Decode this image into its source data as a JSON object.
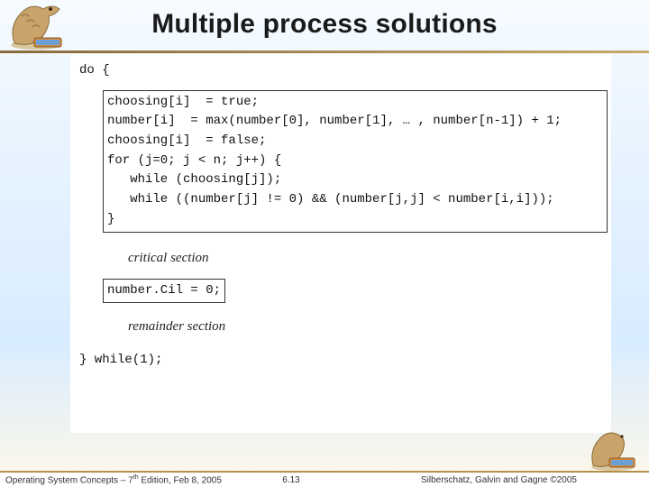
{
  "title": "Multiple process solutions",
  "code": {
    "do_open": "do {",
    "block1_l1": "choosing[i]  = true;",
    "block1_l2": "number[i]  = max(number[0], number[1], … , number[n-1]) + 1;",
    "block1_l3": "choosing[i]  = false;",
    "block1_l4": "for (j=0; j < n; j++) {",
    "block1_l5": "   while (choosing[j]);",
    "block1_l6": "   while ((number[j] != 0) && (number[j,j] < number[i,i]));",
    "block1_l7": "}",
    "critical": "critical section",
    "block2_l1": "number.Cil = 0;",
    "remainder": "remainder section",
    "do_close": "} while(1);"
  },
  "footer": {
    "left_prefix": "Operating System Concepts – 7",
    "left_sup": "th",
    "left_suffix": " Edition, Feb 8, 2005",
    "center": "6.13",
    "right_prefix": "Silberschatz, Galvin and Gagne ",
    "right_copy": "©",
    "right_year": "2005"
  },
  "icons": {
    "dino": "dino-logo"
  }
}
